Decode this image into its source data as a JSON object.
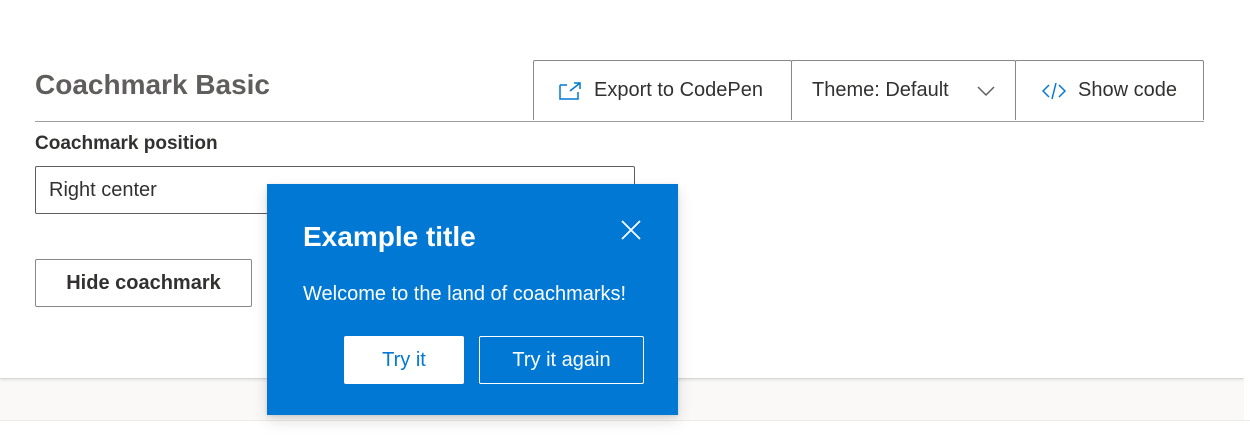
{
  "header": {
    "title": "Coachmark Basic"
  },
  "toolbar": {
    "export_label": "Export to CodePen",
    "theme_label": "Theme: Default",
    "show_code_label": "Show code"
  },
  "form": {
    "position_label": "Coachmark position",
    "position_value": "Right center",
    "hide_button_label": "Hide coachmark"
  },
  "coachmark": {
    "title": "Example title",
    "body": "Welcome to the land of coachmarks!",
    "primary_label": "Try it",
    "secondary_label": "Try it again",
    "background_color": "#0078d4"
  },
  "icons": {
    "export": "export-icon",
    "theme_chevron": "chevron-down-icon",
    "code": "code-icon",
    "close": "close-icon"
  },
  "colors": {
    "accent": "#0078d4",
    "text": "#323130",
    "title_text": "#605e5c"
  }
}
